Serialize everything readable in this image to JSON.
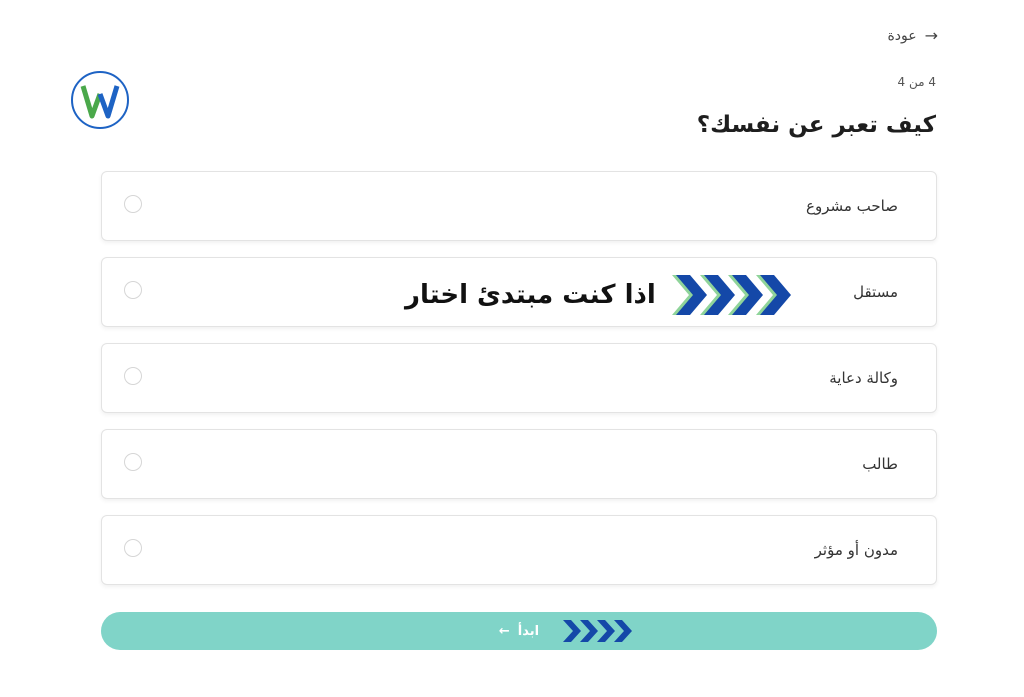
{
  "nav": {
    "back_label": "عودة",
    "back_arrow": "→"
  },
  "progress": {
    "text": "4 من 4",
    "current": 4,
    "total": 4
  },
  "question": "كيف تعبر عن نفسك؟",
  "options": [
    {
      "label": "صاحب مشروع",
      "selected": false
    },
    {
      "label": "مستقل",
      "selected": false
    },
    {
      "label": "وكالة دعاية",
      "selected": false
    },
    {
      "label": "طالب",
      "selected": false
    },
    {
      "label": "مدون أو مؤثر",
      "selected": false
    }
  ],
  "annotation": {
    "text": "اذا كنت مبتدئ اختار"
  },
  "start_button": {
    "label": "ابدأ",
    "arrow": "←"
  },
  "colors": {
    "accent": "#80d4c8",
    "chevron_blue": "#1448a8",
    "chevron_green": "#8fd49a",
    "logo_green": "#4aa84a",
    "logo_blue": "#1e63c4"
  },
  "icons": {
    "logo": "w-logo-icon",
    "back": "arrow-right-icon",
    "annotation": "chevrons-right-icon",
    "start": "chevrons-right-icon"
  }
}
